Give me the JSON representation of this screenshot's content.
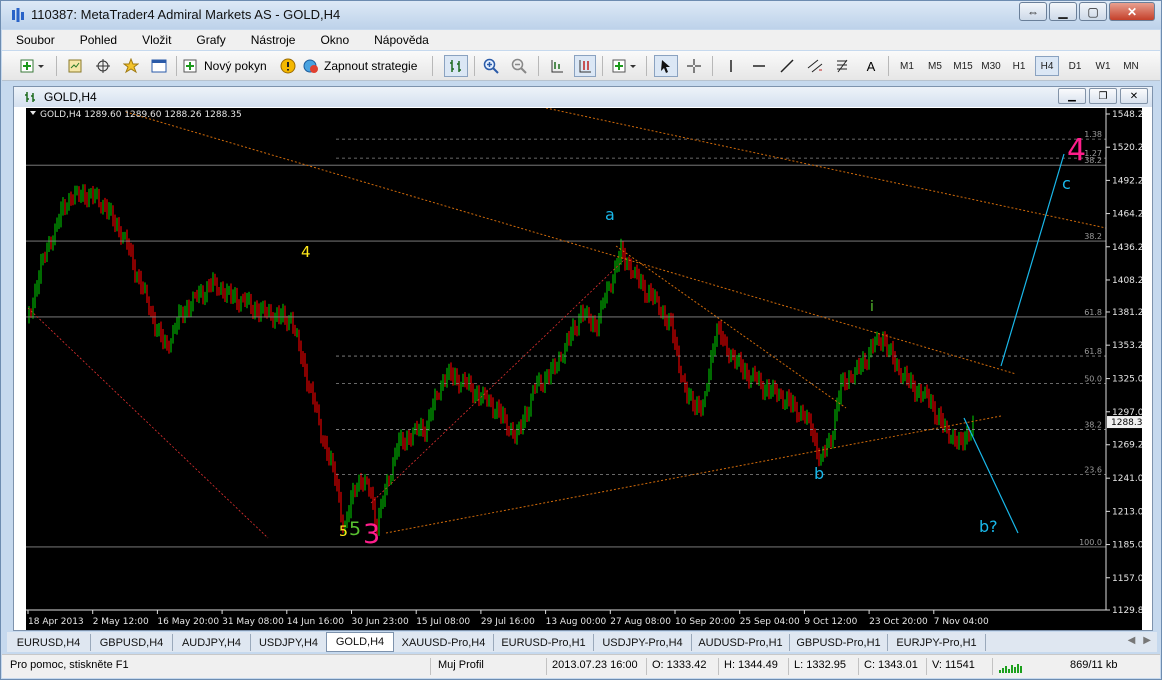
{
  "window": {
    "title": "110387: MetaTrader4 Admiral Markets AS - GOLD,H4"
  },
  "menu": [
    "Soubor",
    "Pohled",
    "Vložit",
    "Grafy",
    "Nástroje",
    "Okno",
    "Nápověda"
  ],
  "toolbar": {
    "new_order": "Nový pokyn",
    "auto_trading": "Zapnout strategie",
    "text_tool": "A",
    "timeframes": [
      "M1",
      "M5",
      "M15",
      "M30",
      "H1",
      "H4",
      "D1",
      "W1",
      "MN"
    ],
    "active_timeframe": "H4"
  },
  "chart_window": {
    "title": "GOLD,H4",
    "info": "GOLD,H4  1289.60 1289.60 1288.26 1288.35",
    "current_price": "1288.35",
    "price_axis": [
      "1548.20",
      "1520.20",
      "1492.20",
      "1464.20",
      "1436.20",
      "1408.20",
      "1381.20",
      "1353.20",
      "1325.00",
      "1297.00",
      "1269.20",
      "1241.00",
      "1213.00",
      "1185.00",
      "1157.00",
      "1129.80"
    ],
    "time_axis": [
      "18 Apr 2013",
      "2 May 12:00",
      "16 May 20:00",
      "31 May 08:00",
      "14 Jun 16:00",
      "30 Jun 23:00",
      "15 Jul 08:00",
      "29 Jul 16:00",
      "13 Aug 00:00",
      "27 Aug 08:00",
      "10 Sep 20:00",
      "25 Sep 04:00",
      "9 Oct 12:00",
      "23 Oct 20:00",
      "7 Nov 04:00"
    ],
    "fib_levels": [
      "1.38",
      "1.27",
      "38.2",
      "38.2",
      "61.8",
      "61.8",
      "50.0",
      "38.2",
      "23.6",
      "100.0"
    ],
    "wave_labels": {
      "w4_yellow": "4",
      "w5_yellow": "5",
      "w5_green": "5",
      "w3_pink": "3",
      "wa": "a",
      "wb": "b",
      "wi": "i",
      "wc": "c",
      "wb2": "b?",
      "w4_pink": "4"
    },
    "colors": {
      "up_candle": "#00b000",
      "down_candle": "#e00000",
      "background": "#000000",
      "trendline": "#d06a0a",
      "wave_line": "#19b8ea",
      "pink": "#ff1e8c",
      "yellow": "#ffe81a"
    }
  },
  "tabs": [
    "EURUSD,H4",
    "GBPUSD,H4",
    "AUDJPY,H4",
    "USDJPY,H4",
    "GOLD,H4",
    "XAUUSD-Pro,H4",
    "EURUSD-Pro,H1",
    "USDJPY-Pro,H4",
    "AUDUSD-Pro,H1",
    "GBPUSD-Pro,H1",
    "EURJPY-Pro,H1"
  ],
  "active_tab": "GOLD,H4",
  "status": {
    "help": "Pro pomoc, stiskněte F1",
    "profile": "Muj Profil",
    "datetime": "2013.07.23 16:00",
    "open": "O: 1333.42",
    "high": "H: 1344.49",
    "low": "L: 1332.95",
    "close": "C: 1343.01",
    "volume": "V: 11541",
    "traffic": "869/11 kb"
  }
}
